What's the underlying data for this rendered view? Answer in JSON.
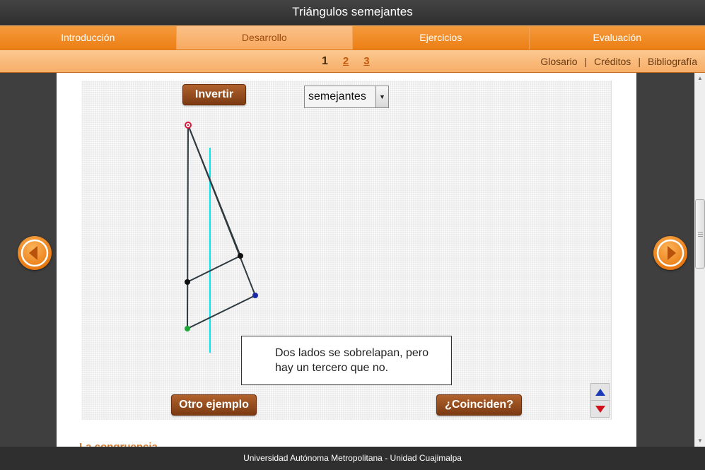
{
  "window": {
    "title": "Triángulos semejantes"
  },
  "tabs": [
    {
      "label": "Introducción",
      "active": false
    },
    {
      "label": "Desarrollo",
      "active": true
    },
    {
      "label": "Ejercicios",
      "active": false
    },
    {
      "label": "Evaluación",
      "active": false
    }
  ],
  "pagination": {
    "pages": [
      "1",
      "2",
      "3"
    ],
    "current": "1"
  },
  "toplinks": {
    "glosario": "Glosario",
    "creditos": "Créditos",
    "bibliografia": "Bibliografía",
    "separator": "|"
  },
  "applet": {
    "invert_label": "Invertir",
    "dropdown_selected": "semejantes",
    "message_line1": "Dos lados se sobrelapan, pero",
    "message_line2": "hay un tercero que no.",
    "another_example_label": "Otro ejemplo",
    "check_label": "¿Coinciden?"
  },
  "next_heading_partial": "La congruencia",
  "footer": {
    "text": "Universidad Autónoma Metropolitana - Unidad Cuajimalpa"
  },
  "colors": {
    "accent_orange": "#ec7f15",
    "button_brown": "#8a4418",
    "cyan_line": "#00e5ee",
    "point_red": "#d81b3a",
    "point_green": "#1fa83a",
    "point_blue": "#1a2aa8"
  },
  "icons": {
    "prev": "chevron-left-icon",
    "next": "chevron-right-icon",
    "up": "triangle-up-icon",
    "down": "triangle-down-icon"
  }
}
